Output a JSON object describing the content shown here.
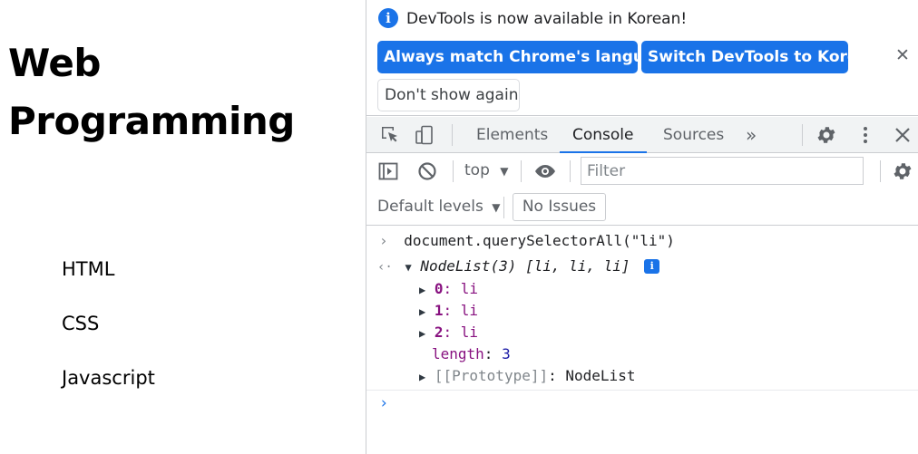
{
  "page": {
    "heading_line1": "Web",
    "heading_line2": "Programming",
    "list_items": [
      "HTML",
      "CSS",
      "Javascript"
    ]
  },
  "devtools": {
    "infobar": {
      "message": "DevTools is now available in Korean!",
      "match_button": "Always match Chrome's language",
      "switch_button": "Switch DevTools to Korean",
      "dont_show_button": "Don't show again",
      "close_glyph": "✕"
    },
    "tabs": {
      "elements": "Elements",
      "console": "Console",
      "sources": "Sources",
      "more": "»"
    },
    "toolbar": {
      "context": "top",
      "filter_placeholder": "Filter",
      "levels": "Default levels",
      "issues": "No Issues"
    },
    "console": {
      "command": "document.querySelectorAll(\"li\")",
      "result_summary": "NodeList(3) [li, li, li]",
      "entries": [
        {
          "key": "0",
          "value": "li"
        },
        {
          "key": "1",
          "value": "li"
        },
        {
          "key": "2",
          "value": "li"
        }
      ],
      "length_key": "length",
      "length_value": "3",
      "prototype_key": "[[Prototype]]",
      "prototype_value": "NodeList"
    },
    "colors": {
      "accent": "#1a73e8",
      "tab_background": "#f1f3f4",
      "key_color": "#881280",
      "value_color": "#1a1aa6"
    },
    "icons": [
      "info-icon",
      "inspect-element-icon",
      "device-toolbar-icon",
      "more-tabs-icon",
      "settings-icon",
      "kebab-menu-icon",
      "close-icon",
      "sidebar-toggle-icon",
      "clear-console-icon",
      "eye-icon",
      "console-settings-icon"
    ]
  }
}
